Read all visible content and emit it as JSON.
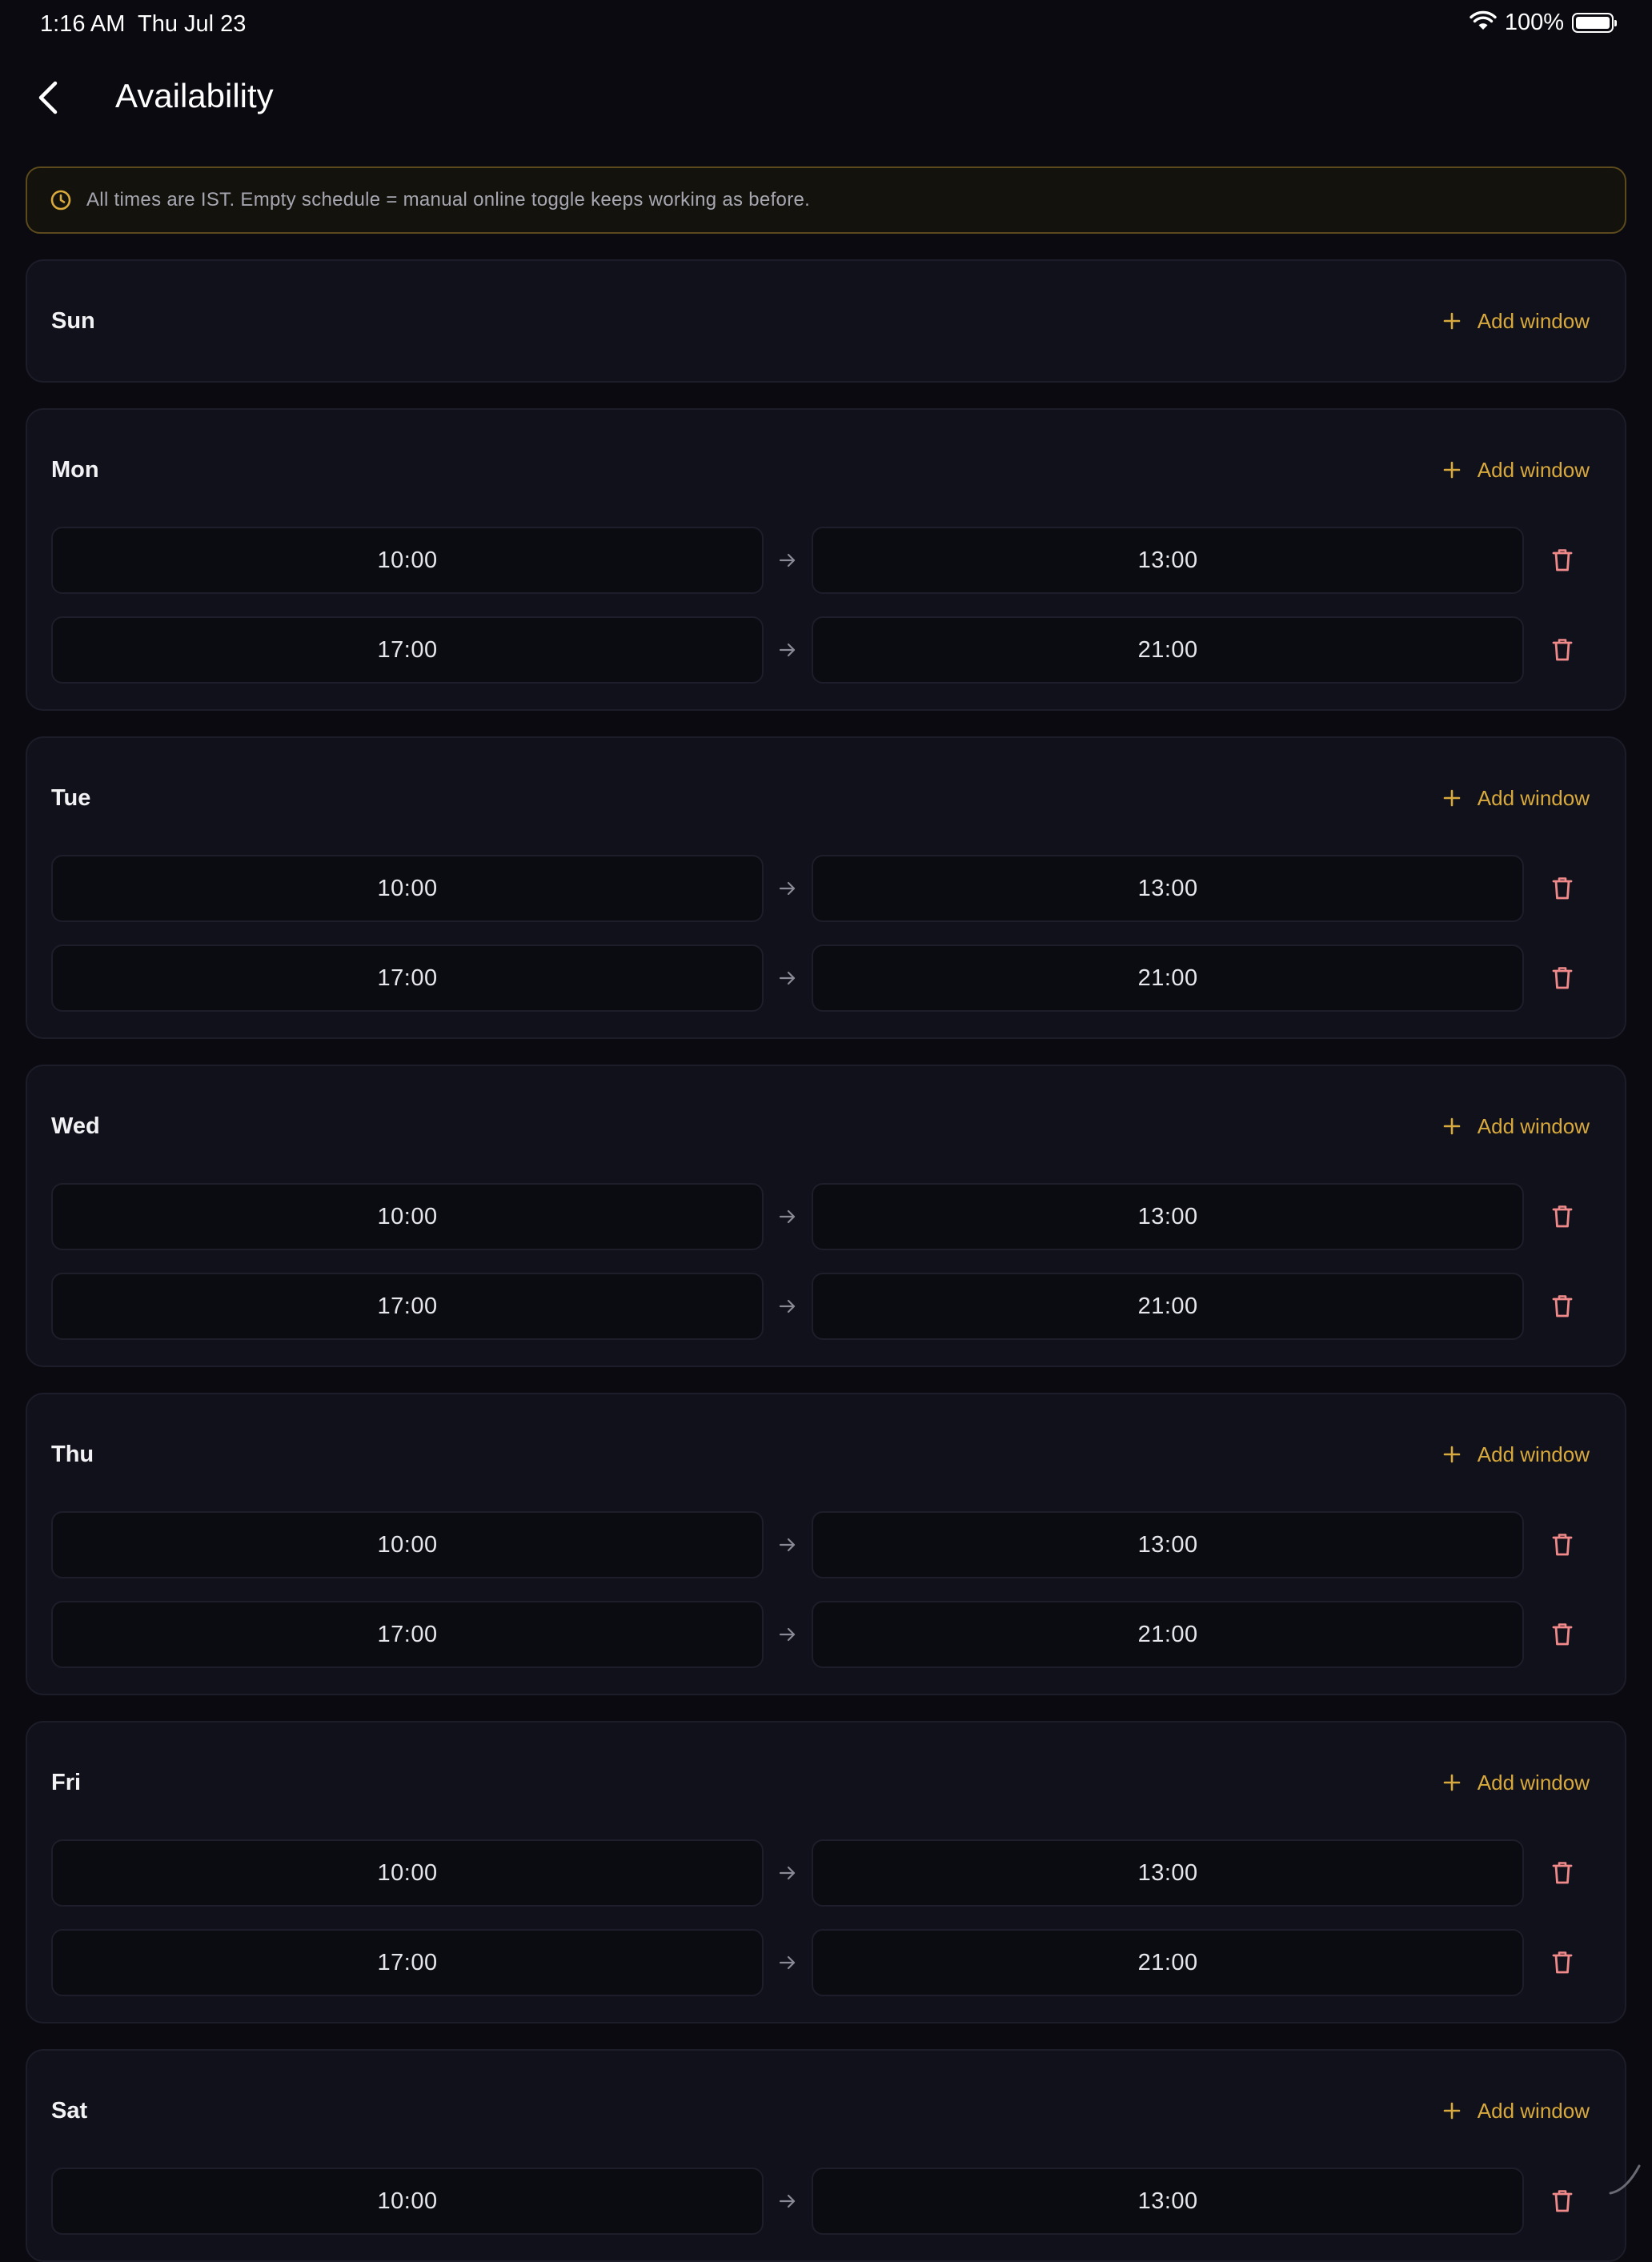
{
  "status_bar": {
    "time": "1:16 AM",
    "date": "Thu Jul 23",
    "battery_percent": "100%",
    "battery_level": 1.0
  },
  "nav": {
    "title": "Availability"
  },
  "notice": {
    "text": "All times are IST. Empty schedule = manual online toggle keeps working as before."
  },
  "colors": {
    "accent": "#d8a93c",
    "delete": "#f08a8a",
    "background": "#0a0a10",
    "card": "#11111b"
  },
  "add_window_label": "Add window",
  "days": [
    {
      "name": "Sun",
      "windows": []
    },
    {
      "name": "Mon",
      "windows": [
        {
          "start": "10:00",
          "end": "13:00"
        },
        {
          "start": "17:00",
          "end": "21:00"
        }
      ]
    },
    {
      "name": "Tue",
      "windows": [
        {
          "start": "10:00",
          "end": "13:00"
        },
        {
          "start": "17:00",
          "end": "21:00"
        }
      ]
    },
    {
      "name": "Wed",
      "windows": [
        {
          "start": "10:00",
          "end": "13:00"
        },
        {
          "start": "17:00",
          "end": "21:00"
        }
      ]
    },
    {
      "name": "Thu",
      "windows": [
        {
          "start": "10:00",
          "end": "13:00"
        },
        {
          "start": "17:00",
          "end": "21:00"
        }
      ]
    },
    {
      "name": "Fri",
      "windows": [
        {
          "start": "10:00",
          "end": "13:00"
        },
        {
          "start": "17:00",
          "end": "21:00"
        }
      ]
    },
    {
      "name": "Sat",
      "windows": [
        {
          "start": "10:00",
          "end": "13:00"
        }
      ]
    }
  ]
}
